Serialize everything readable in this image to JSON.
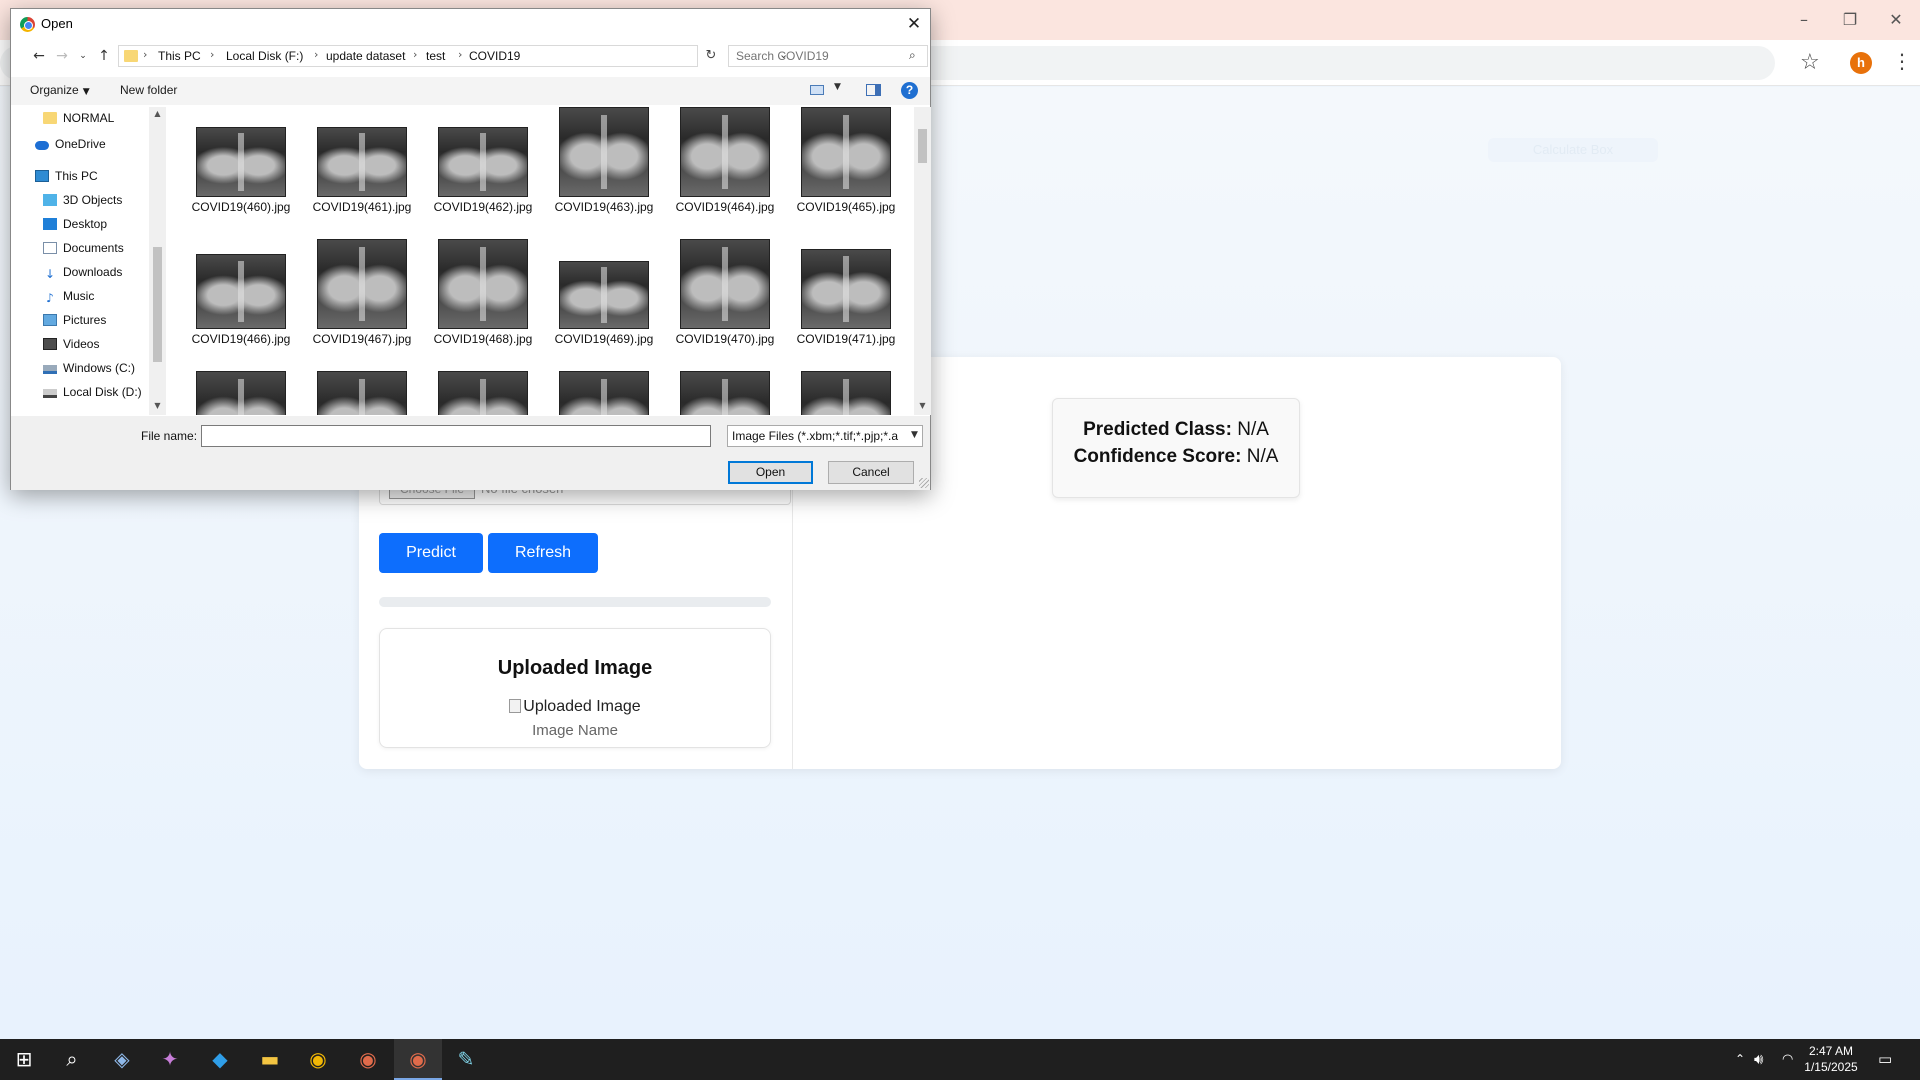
{
  "browser": {
    "window_controls": [
      "–",
      "❐",
      "✕"
    ],
    "bookmark_icon": "star-icon",
    "profile_initial": "h",
    "menu_icon": "kebab-icon",
    "ghost_button": "Calculate Box"
  },
  "app": {
    "file_input": {
      "button": "Choose File",
      "status": "No file chosen"
    },
    "predict_label": "Predict",
    "refresh_label": "Refresh",
    "progress": 0,
    "upload_title": "Uploaded Image",
    "upload_img_alt": "Uploaded Image",
    "upload_name": "Image Name",
    "result": {
      "class_label": "Predicted Class:",
      "class_value": "N/A",
      "score_label": "Confidence Score:",
      "score_value": "N/A"
    },
    "accent": "#0d6efd"
  },
  "dialog": {
    "title": "Open",
    "breadcrumb": [
      "This PC",
      "Local Disk (F:)",
      "update dataset",
      "test",
      "COVID19"
    ],
    "search_placeholder": "Search COVID19",
    "organize": "Organize",
    "new_folder": "New folder",
    "nav_items": [
      {
        "label": "NORMAL",
        "icon": "folder"
      },
      {
        "label": "OneDrive",
        "icon": "cloud"
      },
      {
        "label": "This PC",
        "icon": "pc"
      },
      {
        "label": "3D Objects",
        "icon": "3d"
      },
      {
        "label": "Desktop",
        "icon": "desktop"
      },
      {
        "label": "Documents",
        "icon": "docs"
      },
      {
        "label": "Downloads",
        "icon": "down"
      },
      {
        "label": "Music",
        "icon": "music"
      },
      {
        "label": "Pictures",
        "icon": "pics"
      },
      {
        "label": "Videos",
        "icon": "videos"
      },
      {
        "label": "Windows (C:)",
        "icon": "drive-c"
      },
      {
        "label": "Local Disk (D:)",
        "icon": "drive"
      }
    ],
    "files": [
      "COVID19(460).jpg",
      "COVID19(461).jpg",
      "COVID19(462).jpg",
      "COVID19(463).jpg",
      "COVID19(464).jpg",
      "COVID19(465).jpg",
      "COVID19(466).jpg",
      "COVID19(467).jpg",
      "COVID19(468).jpg",
      "COVID19(469).jpg",
      "COVID19(470).jpg",
      "COVID19(471).jpg",
      "",
      "",
      "",
      "",
      "",
      ""
    ],
    "file_name_label": "File name:",
    "file_name_value": "",
    "file_type": "Image Files (*.xbm;*.tif;*.pjp;*.a",
    "open_label": "Open",
    "cancel_label": "Cancel"
  },
  "taskbar": {
    "apps": [
      "windows-start-icon",
      "search-icon",
      "teams-icon",
      "copilot-icon",
      "vscode-icon",
      "file-explorer-icon",
      "chrome-icon",
      "chrome-profile-icon",
      "chrome-active-icon",
      "notepad-icon"
    ],
    "tray_icons": [
      "chevron-up-icon",
      "volume-icon",
      "wifi-icon",
      "notification-icon"
    ],
    "time": "2:47 AM",
    "date": "1/15/2025"
  }
}
